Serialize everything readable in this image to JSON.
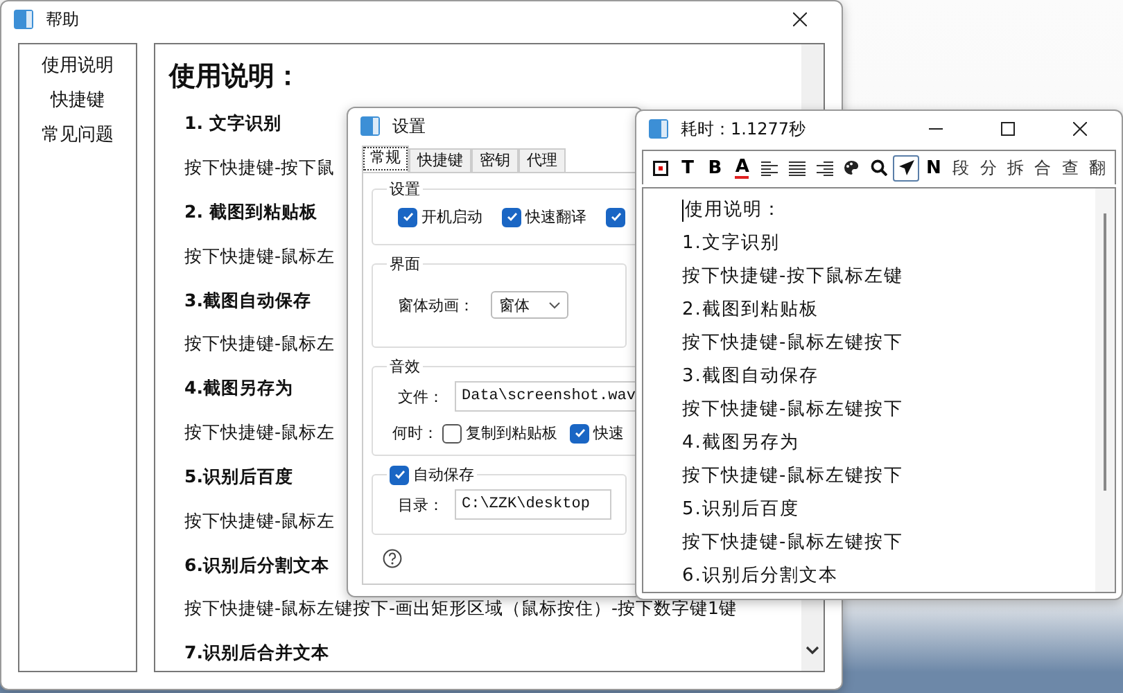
{
  "help_window": {
    "title": "帮助",
    "sidebar": {
      "items": [
        {
          "label": "使用说明",
          "selected": false
        },
        {
          "label": "快捷键",
          "selected": false
        },
        {
          "label": "常见问题",
          "selected": false
        }
      ]
    },
    "content": {
      "heading": "使用说明：",
      "items": [
        {
          "kind": "heading",
          "text": "1. 文字识别"
        },
        {
          "kind": "body",
          "text": "按下快捷键-按下鼠"
        },
        {
          "kind": "heading",
          "text": "2. 截图到粘贴板"
        },
        {
          "kind": "body",
          "text": "按下快捷键-鼠标左"
        },
        {
          "kind": "heading",
          "text": "3.截图自动保存"
        },
        {
          "kind": "body",
          "text": "按下快捷键-鼠标左"
        },
        {
          "kind": "heading",
          "text": "4.截图另存为"
        },
        {
          "kind": "body",
          "text": "按下快捷键-鼠标左"
        },
        {
          "kind": "heading",
          "text": "5.识别后百度"
        },
        {
          "kind": "body",
          "text": "按下快捷键-鼠标左"
        },
        {
          "kind": "heading",
          "text": "6.识别后分割文本"
        },
        {
          "kind": "body",
          "text": "按下快捷键-鼠标左键按下-画出矩形区域（鼠标按住）-按下数字键1键"
        },
        {
          "kind": "heading",
          "text": "7.识别后合并文本"
        }
      ]
    }
  },
  "settings_window": {
    "title": "设置",
    "tabs": [
      {
        "label": "常规",
        "selected": true
      },
      {
        "label": "快捷键",
        "selected": false
      },
      {
        "label": "密钥",
        "selected": false
      },
      {
        "label": "代理",
        "selected": false
      }
    ],
    "settings_group": {
      "title": "设置",
      "checkboxes": [
        {
          "label": "开机启动",
          "checked": true
        },
        {
          "label": "快速翻译",
          "checked": true
        },
        {
          "checked": true
        }
      ]
    },
    "interface_group": {
      "title": "界面",
      "animation_label": "窗体动画：",
      "animation_value": "窗体"
    },
    "sound_group": {
      "title": "音效",
      "file_label": "文件：",
      "file_value": "Data\\screenshot.wav",
      "when_label": "何时：",
      "checkboxes": [
        {
          "label": "复制到粘贴板",
          "checked": false
        },
        {
          "label": "快速",
          "checked": true
        }
      ]
    },
    "autosave_group": {
      "title": "自动保存",
      "checked": true,
      "dir_label": "目录：",
      "dir_value": "C:\\ZZK\\desktop"
    }
  },
  "result_window": {
    "title": "耗时：1.1277秒",
    "toolbar": [
      {
        "kind": "stop",
        "selected": false
      },
      {
        "kind": "letter",
        "label": "T",
        "selected": false
      },
      {
        "kind": "letter",
        "label": "B",
        "selected": false
      },
      {
        "kind": "font-color",
        "label": "A",
        "selected": false
      },
      {
        "kind": "align-left",
        "selected": false
      },
      {
        "kind": "justify",
        "selected": false
      },
      {
        "kind": "align-right",
        "selected": false
      },
      {
        "kind": "paint",
        "selected": false
      },
      {
        "kind": "search",
        "selected": false
      },
      {
        "kind": "send",
        "selected": true
      },
      {
        "kind": "letter",
        "label": "N",
        "selected": false
      },
      {
        "kind": "char",
        "label": "段",
        "selected": false
      },
      {
        "kind": "char",
        "label": "分",
        "selected": false
      },
      {
        "kind": "char",
        "label": "拆",
        "selected": false
      },
      {
        "kind": "char",
        "label": "合",
        "selected": false
      },
      {
        "kind": "char",
        "label": "查",
        "selected": false
      },
      {
        "kind": "char",
        "label": "翻",
        "selected": false
      }
    ],
    "lines": [
      "使用说明：",
      "1.文字识别",
      "按下快捷键-按下鼠标左键",
      "2.截图到粘贴板",
      "按下快捷键-鼠标左键按下",
      "3.截图自动保存",
      "按下快捷键-鼠标左键按下",
      "4.截图另存为",
      "按下快捷键-鼠标左键按下",
      "5.识别后百度",
      "按下快捷键-鼠标左键按下",
      "6.识别后分割文本"
    ]
  }
}
